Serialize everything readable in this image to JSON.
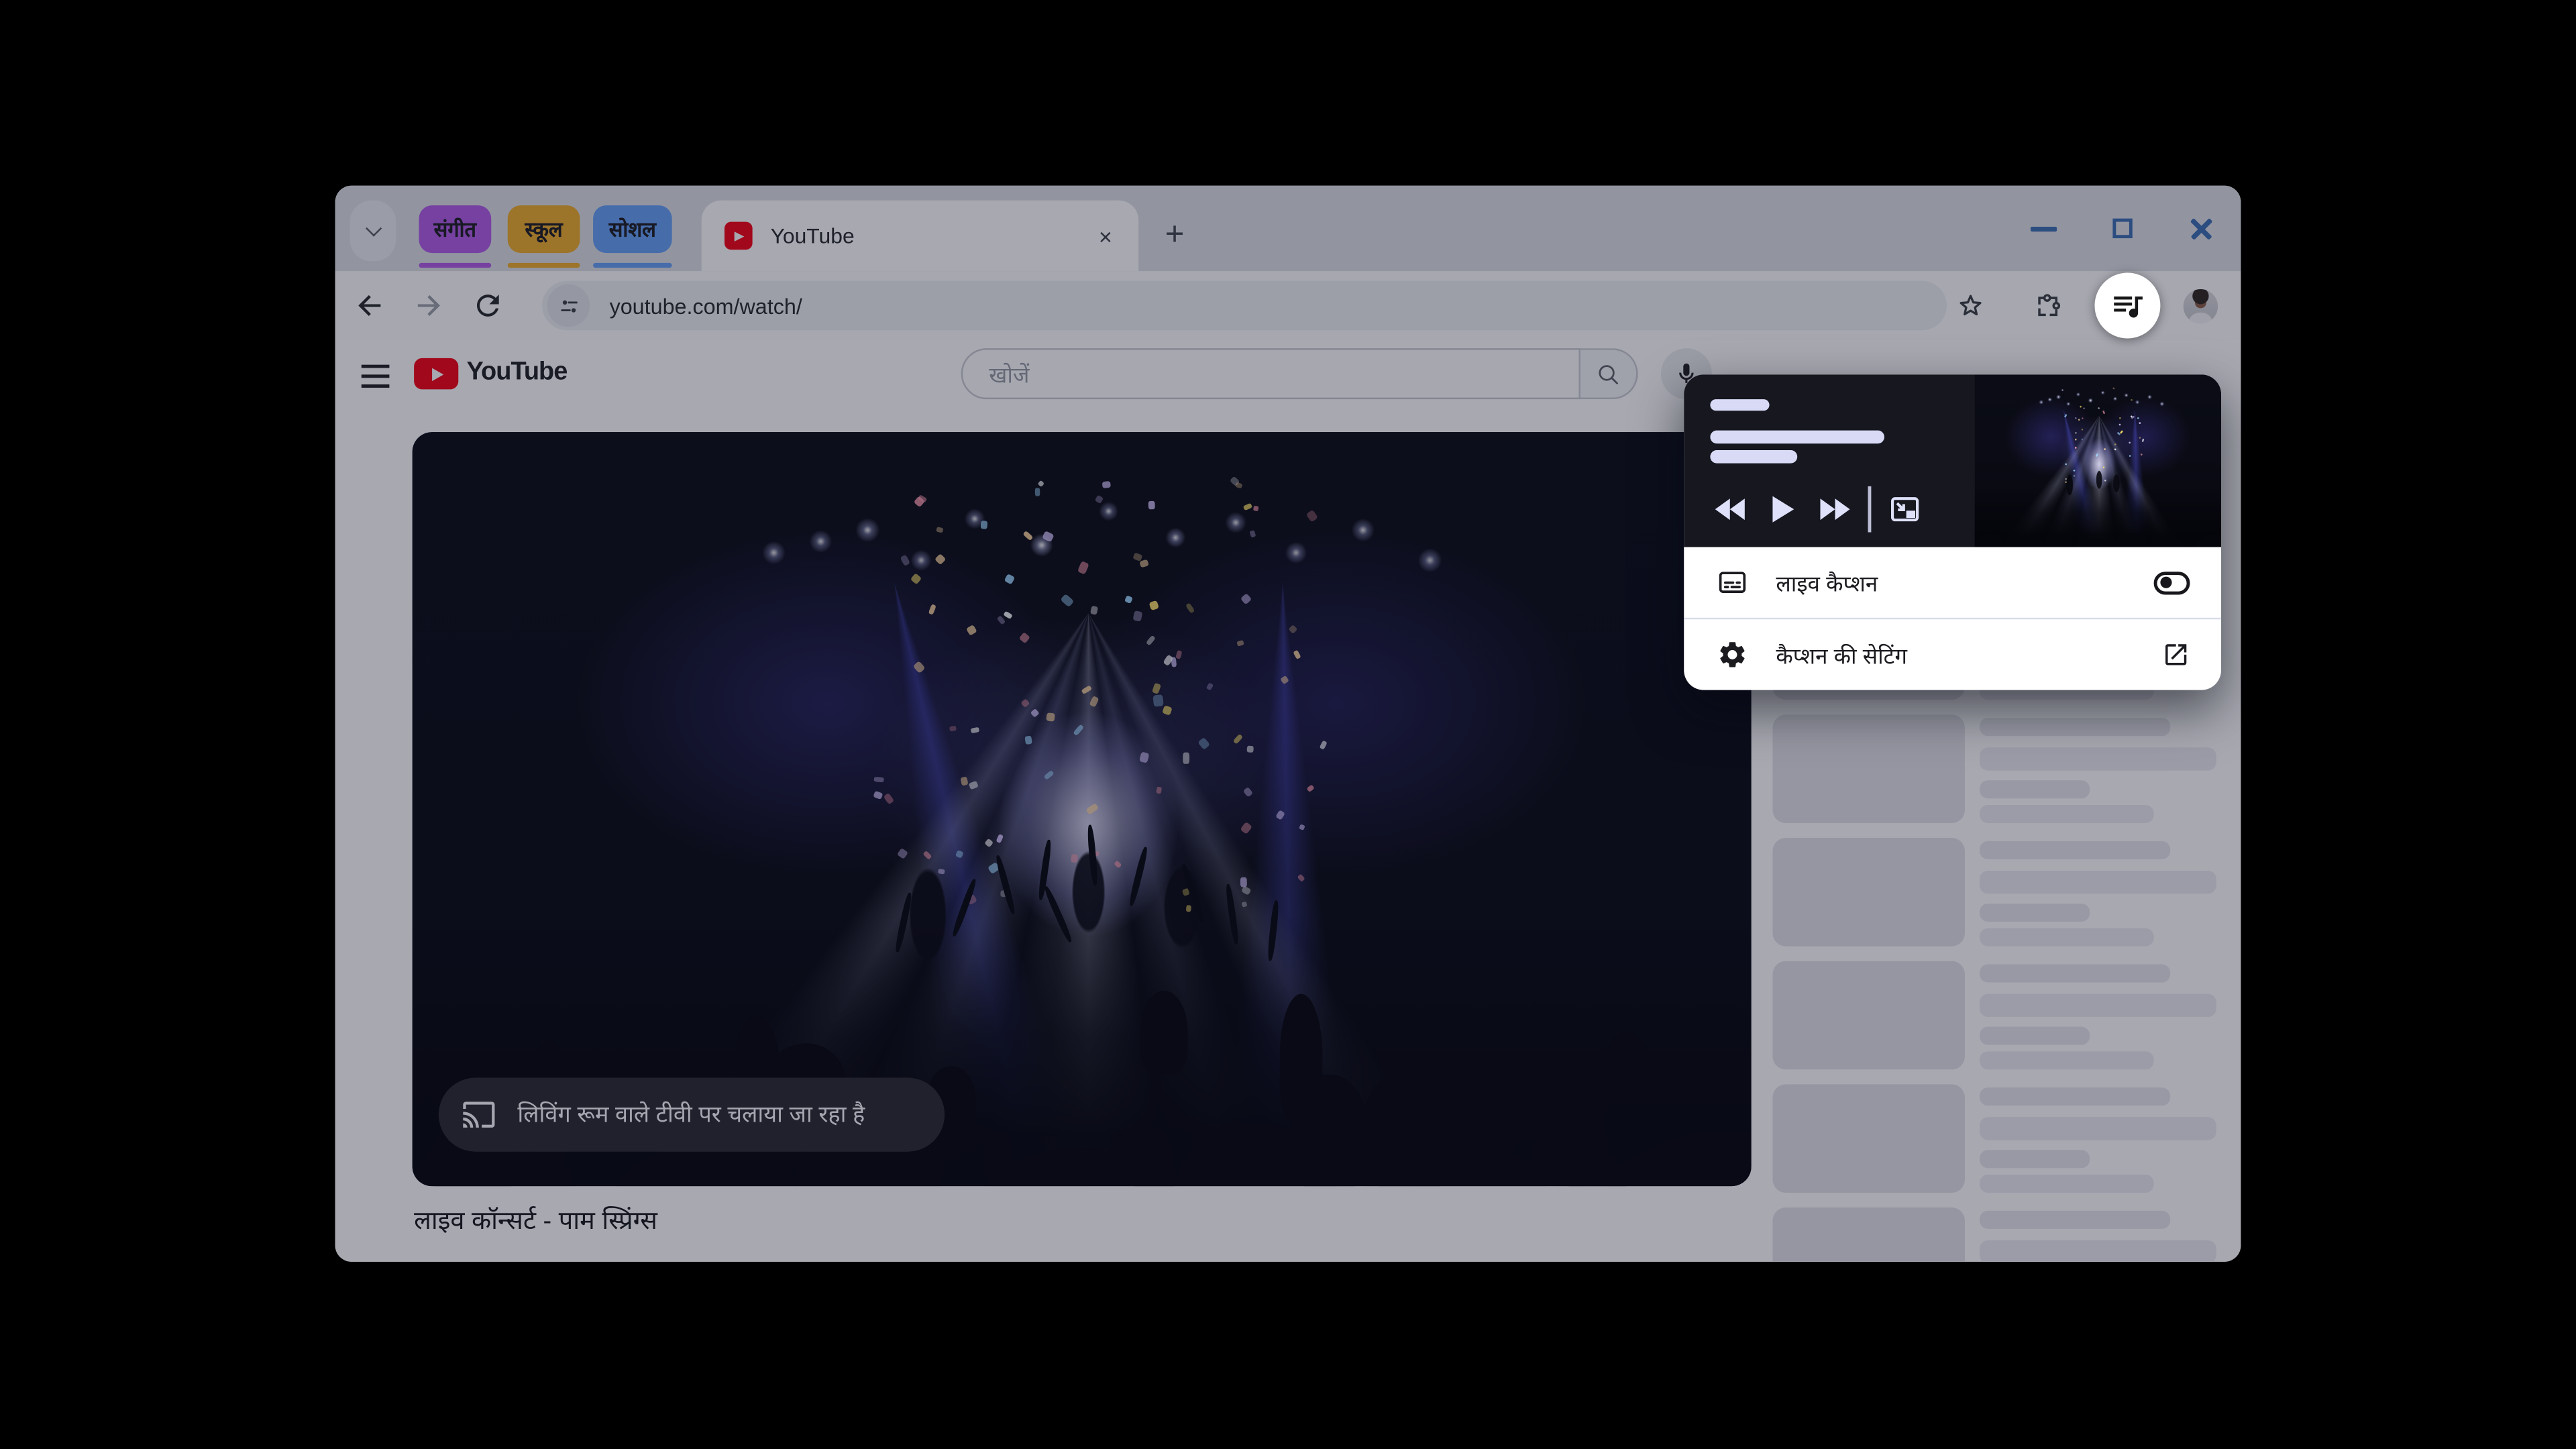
{
  "browser": {
    "tab_groups": [
      {
        "label": "संगीत",
        "color": "#b25ce8"
      },
      {
        "label": "स्कूल",
        "color": "#eead2b"
      },
      {
        "label": "सोशल",
        "color": "#66a1f5"
      }
    ],
    "active_tab_title": "YouTube",
    "new_tab_glyph": "+",
    "tab_close_glyph": "×",
    "url": "youtube.com/watch/"
  },
  "youtube": {
    "search_placeholder": "खोजें",
    "video_title": "लाइव कॉन्सर्ट - पाम स्प्रिंग्स",
    "cast_overlay_text": "लिविंग रूम वाले टीवी पर चलाया जा रहा है",
    "related_skeleton_items": 6
  },
  "media_popup": {
    "live_caption_label": "लाइव कैप्शन",
    "live_caption_enabled": false,
    "caption_settings_label": "कैप्शन की सेटिंग",
    "loading_bars": 3
  },
  "colors": {
    "group_music": "#b25ce8",
    "group_school": "#eead2b",
    "group_social": "#66a1f5",
    "youtube_red": "#f50314",
    "window_control_blue": "#3d6fb3",
    "popup_bg": "#16171f",
    "popup_accent": "#d9dbf6",
    "scrim": "rgba(15,20,40,0.37)",
    "cast_pill_bg": "#2a2a2f"
  }
}
